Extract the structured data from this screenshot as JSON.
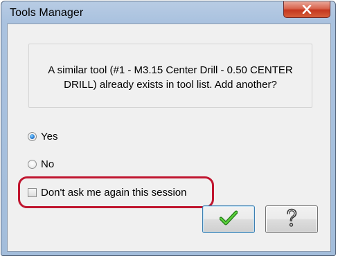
{
  "window": {
    "title": "Tools Manager"
  },
  "message": {
    "text": "A similar tool (#1 - M3.15 Center Drill - 0.50 CENTER\nDRILL) already exists in tool list.  Add another?"
  },
  "options": {
    "yes_label": "Yes",
    "yes_selected": true,
    "no_label": "No",
    "no_selected": false
  },
  "dont_ask": {
    "label": "Don't ask me again this session",
    "checked": false
  },
  "buttons": {
    "ok_icon": "checkmark-icon",
    "help_icon": "question-mark-icon"
  },
  "colors": {
    "highlight": "#c0152f",
    "checkmark": "#2e9a1e",
    "close_button": "#c4381f"
  }
}
